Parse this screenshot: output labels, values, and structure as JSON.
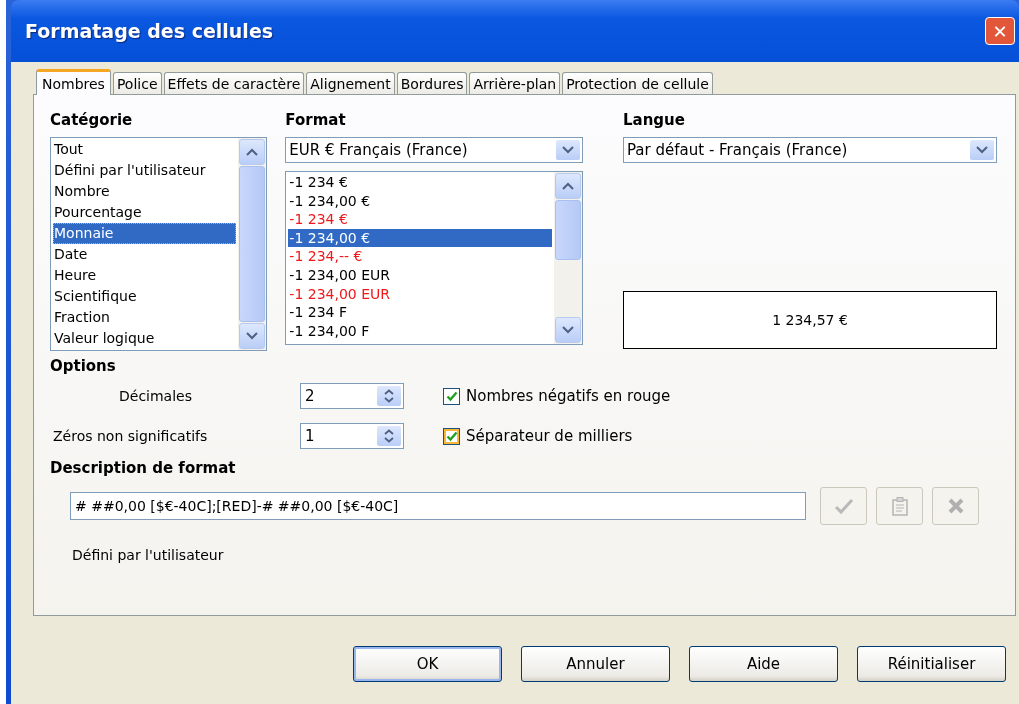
{
  "window": {
    "title": "Formatage des cellules",
    "close": "✕"
  },
  "tabs": [
    {
      "label": "Nombres",
      "selected": true
    },
    {
      "label": "Police",
      "selected": false
    },
    {
      "label": "Effets de caractère",
      "selected": false
    },
    {
      "label": "Alignement",
      "selected": false
    },
    {
      "label": "Bordures",
      "selected": false
    },
    {
      "label": "Arrière-plan",
      "selected": false
    },
    {
      "label": "Protection de cellule",
      "selected": false
    }
  ],
  "category": {
    "label": "Catégorie",
    "items": [
      {
        "label": "Tout",
        "selected": false
      },
      {
        "label": "Défini par l'utilisateur",
        "selected": false
      },
      {
        "label": "Nombre",
        "selected": false
      },
      {
        "label": "Pourcentage",
        "selected": false
      },
      {
        "label": "Monnaie",
        "selected": true
      },
      {
        "label": "Date",
        "selected": false
      },
      {
        "label": "Heure",
        "selected": false
      },
      {
        "label": "Scientifique",
        "selected": false
      },
      {
        "label": "Fraction",
        "selected": false
      },
      {
        "label": "Valeur logique",
        "selected": false
      }
    ]
  },
  "format": {
    "label": "Format",
    "dropdown": "EUR  €  Français (France)",
    "items": [
      {
        "label": "-1 234 €",
        "negative_red": false,
        "selected": false
      },
      {
        "label": "-1 234,00 €",
        "negative_red": false,
        "selected": false
      },
      {
        "label": "-1 234 €",
        "negative_red": true,
        "selected": false
      },
      {
        "label": "-1 234,00 €",
        "negative_red": false,
        "selected": true
      },
      {
        "label": "-1 234,-- €",
        "negative_red": true,
        "selected": false
      },
      {
        "label": "-1 234,00 EUR",
        "negative_red": false,
        "selected": false
      },
      {
        "label": "-1 234,00 EUR",
        "negative_red": true,
        "selected": false
      },
      {
        "label": "-1 234 F",
        "negative_red": false,
        "selected": false
      },
      {
        "label": "-1 234,00 F",
        "negative_red": false,
        "selected": false
      }
    ]
  },
  "language": {
    "label": "Langue",
    "dropdown": "Par défaut - Français (France)"
  },
  "preview": "1 234,57 €",
  "options": {
    "label": "Options",
    "decimals": {
      "label": "Décimales",
      "value": "2"
    },
    "leading_zeros": {
      "label": "Zéros non significatifs",
      "value": "1"
    },
    "negative_red": {
      "label": "Nombres négatifs en rouge",
      "checked": true
    },
    "thousands_separator": {
      "label": "Séparateur de milliers",
      "checked": true
    }
  },
  "format_code": {
    "label": "Description de format",
    "value": "# ##0,00 [$€-40C];[RED]-# ##0,00 [$€-40C]",
    "buttons": [
      {
        "kind": "add",
        "disabled": true
      },
      {
        "kind": "edit",
        "disabled": true
      },
      {
        "kind": "delete",
        "disabled": true
      }
    ],
    "comment": "Défini par l'utilisateur"
  },
  "buttons": [
    {
      "label": "OK",
      "default": true
    },
    {
      "label": "Annuler",
      "default": false
    },
    {
      "label": "Aide",
      "default": false
    },
    {
      "label": "Réinitialiser",
      "default": false
    }
  ]
}
